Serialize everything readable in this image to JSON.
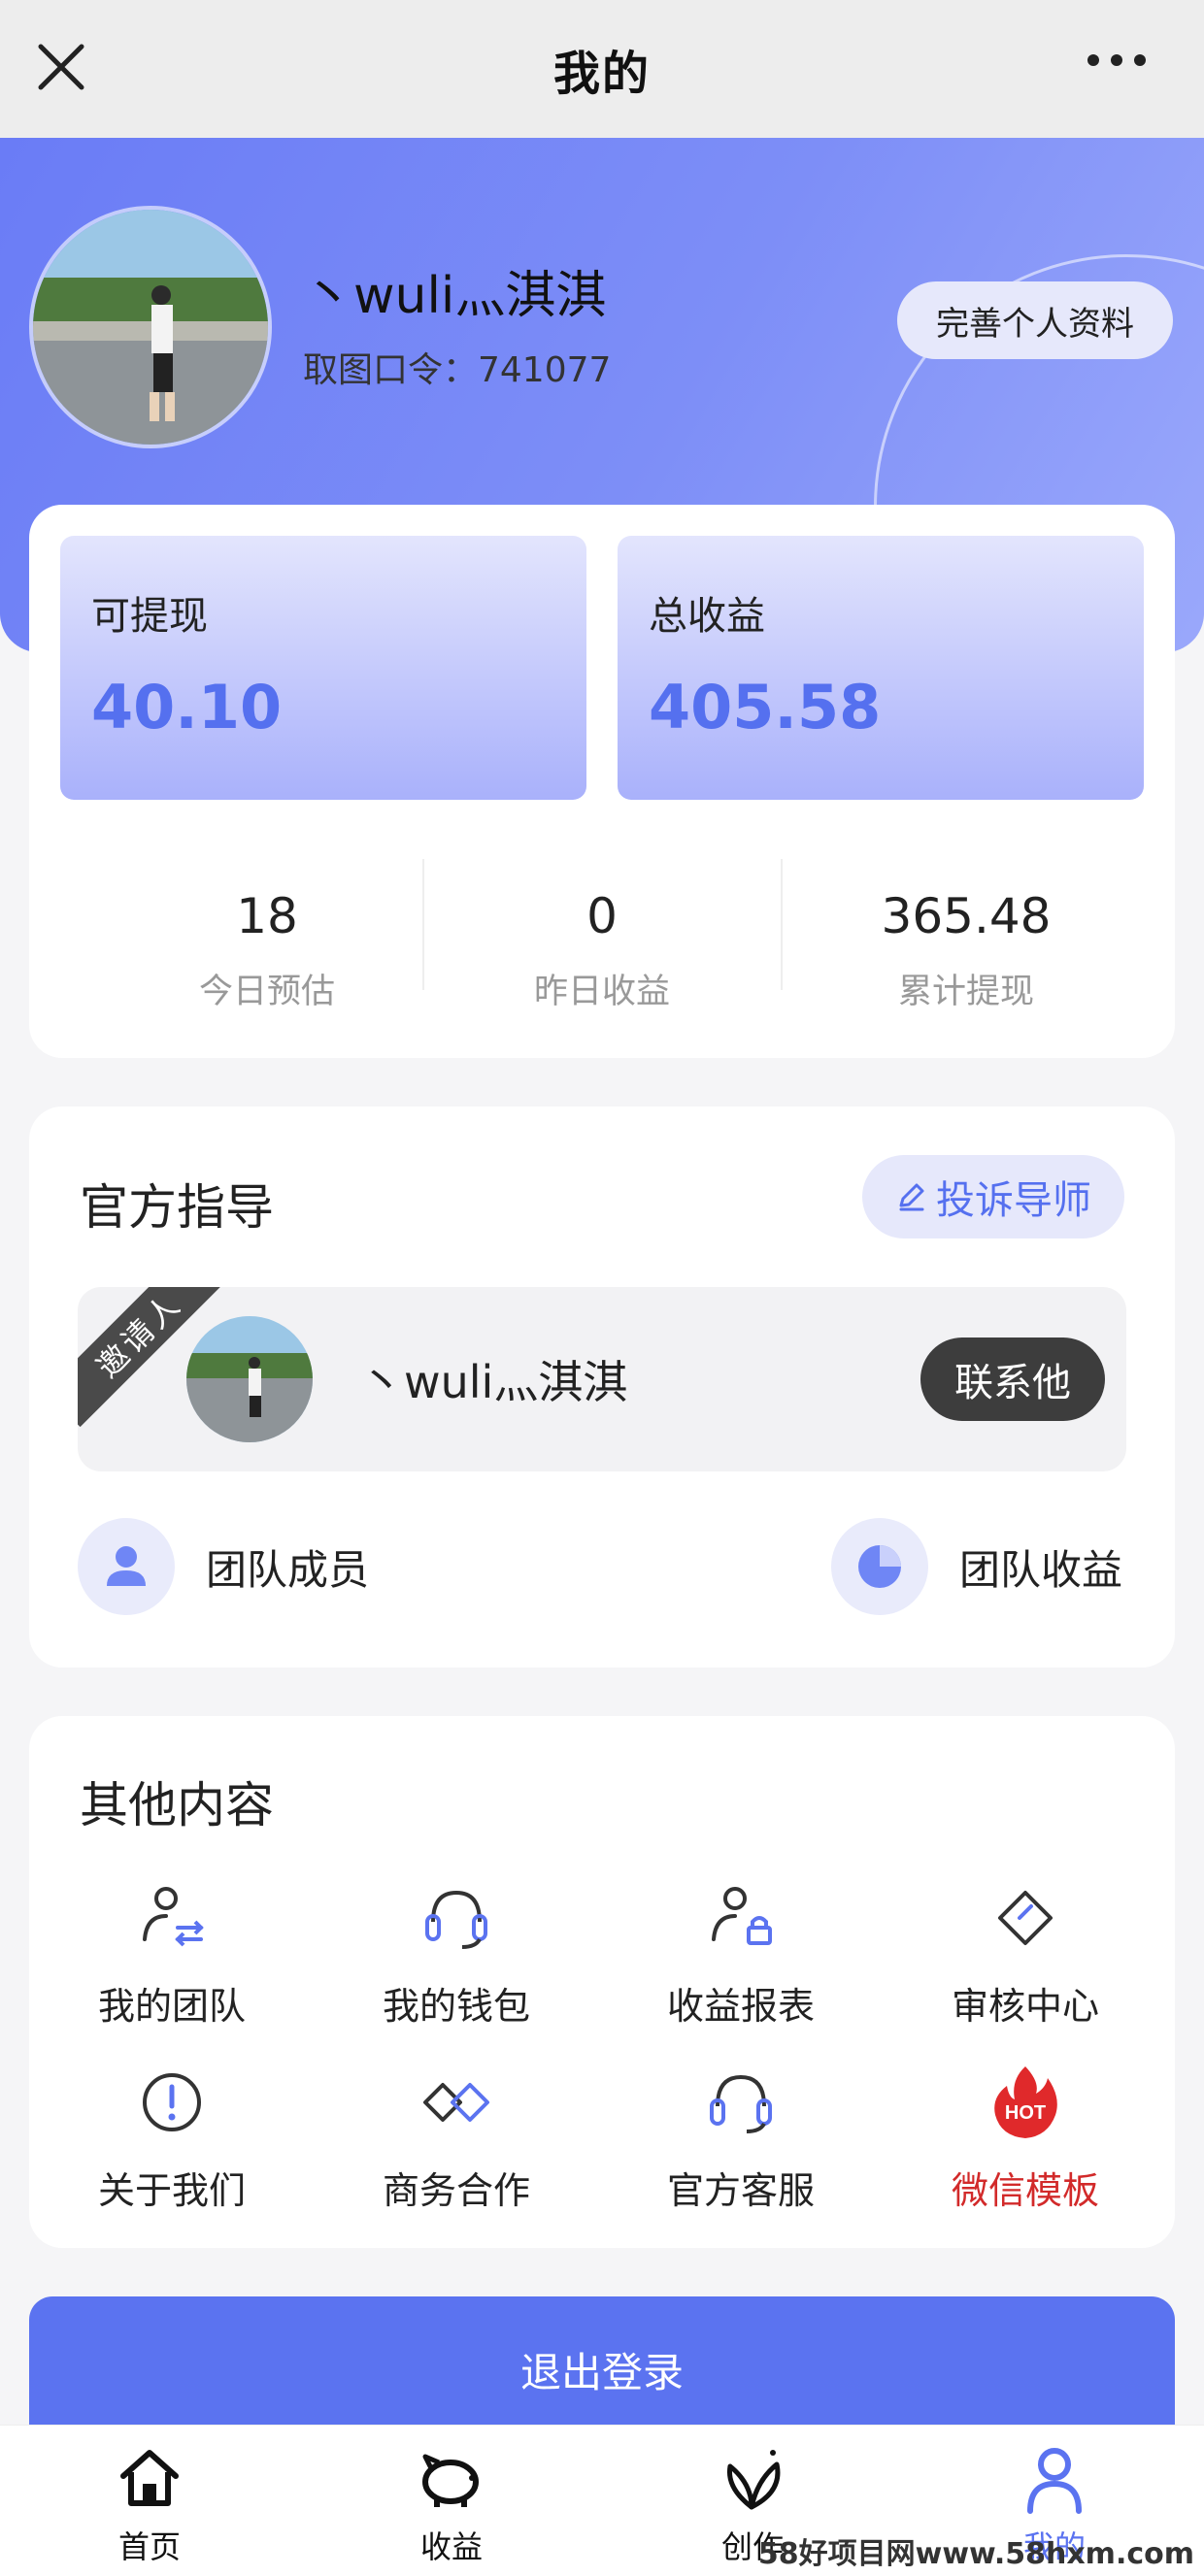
{
  "topbar": {
    "title": "我的",
    "close_icon": "close-icon",
    "more_icon": "more-icon"
  },
  "profile": {
    "username": "丶wuli灬淇淇",
    "code_label": "取图口令：741077",
    "edit_button": "完善个人资料"
  },
  "earnings": {
    "withdrawable_label": "可提现",
    "withdrawable_value": "40.10",
    "total_label": "总收益",
    "total_value": "405.58",
    "stats": [
      {
        "value": "18",
        "label": "今日预估"
      },
      {
        "value": "0",
        "label": "昨日收益"
      },
      {
        "value": "365.48",
        "label": "累计提现"
      }
    ]
  },
  "guide": {
    "title": "官方指导",
    "complain_button": "投诉导师",
    "inviter_ribbon": "邀请人",
    "inviter_name": "丶wuli灬淇淇",
    "contact_button": "联系他",
    "team_members": "团队成员",
    "team_earnings": "团队收益"
  },
  "other": {
    "title": "其他内容",
    "items": [
      {
        "label": "我的团队",
        "icon": "team-icon"
      },
      {
        "label": "我的钱包",
        "icon": "wallet-icon"
      },
      {
        "label": "收益报表",
        "icon": "report-icon"
      },
      {
        "label": "审核中心",
        "icon": "review-icon"
      },
      {
        "label": "关于我们",
        "icon": "info-icon"
      },
      {
        "label": "商务合作",
        "icon": "handshake-icon"
      },
      {
        "label": "官方客服",
        "icon": "headset-icon"
      },
      {
        "label": "微信模板",
        "icon": "hot-icon"
      }
    ]
  },
  "logout_button": "退出登录",
  "tabs": [
    {
      "label": "首页",
      "icon": "home-icon"
    },
    {
      "label": "收益",
      "icon": "piggy-icon"
    },
    {
      "label": "创作",
      "icon": "leaf-icon"
    },
    {
      "label": "我的",
      "icon": "user-icon",
      "active": true
    }
  ],
  "watermark": "58好项目网www.58hxm.com",
  "colors": {
    "accent": "#5b73f0",
    "hot": "#d22a2a"
  }
}
